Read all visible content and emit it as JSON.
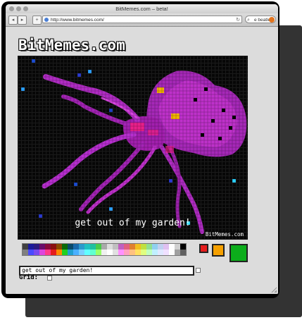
{
  "window": {
    "title": "BitMemes.com – beta!"
  },
  "toolbar": {
    "back_label": "◂",
    "forward_label": "▸",
    "add_label": "+",
    "url": "http://www.bitmemes.com/",
    "reload_label": "↻",
    "search_value": "e beatles",
    "search_icon_label": "⌕"
  },
  "site": {
    "logo": "BitMemes.com",
    "caption": "get out of my garden!",
    "watermark": "BitMemes.com",
    "text_value": "get out of my garden!",
    "grid_label": "Grid:"
  },
  "palette": [
    "#404040",
    "#1a1a9a",
    "#2a1a80",
    "#6a0d6a",
    "#8a0a3a",
    "#8a1010",
    "#8a4a00",
    "#0a6a0a",
    "#0a4a6a",
    "#1a6aaa",
    "#2a9acc",
    "#20c0c0",
    "#20c0a0",
    "#4acc4a",
    "#aaaaaa",
    "#dddddd",
    "#c0c0c0",
    "#c060c0",
    "#e06080",
    "#e08030",
    "#f0c020",
    "#c0e040",
    "#90e090",
    "#90d0f0",
    "#c0d0f0",
    "#e0c0f0",
    "#ffffff",
    "#d0d0d0",
    "#000000",
    "#808080",
    "#4a4aff",
    "#7a4aee",
    "#dd44dd",
    "#ff3a8a",
    "#e51c1c",
    "#ff8a00",
    "#20d020",
    "#20a0d0",
    "#4ab0ff",
    "#7ad0ff",
    "#60ffff",
    "#60ffd0",
    "#9aff6a",
    "#f0f0f0",
    "#ffffff",
    "#e0e0e0",
    "#ff90ff",
    "#ffa0c0",
    "#ffc080",
    "#ffe060",
    "#e0ff80",
    "#c0ffc0",
    "#c0f0ff",
    "#e0e8ff",
    "#f0e0ff",
    "#ffffff",
    "#a0a0a0",
    "#606060"
  ],
  "current_colors": {
    "primary": "#e51c1c",
    "secondary": "#f5a000",
    "tertiary": "#0cad1b"
  }
}
